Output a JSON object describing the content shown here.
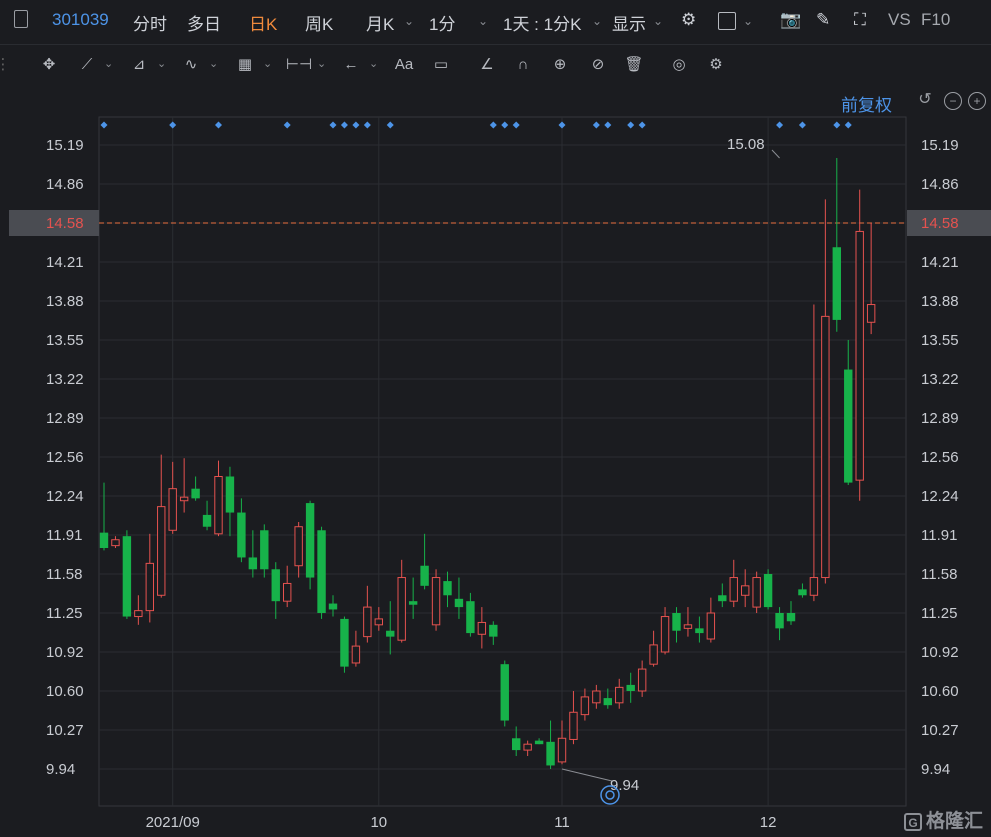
{
  "header": {
    "stock_code": "301039",
    "tabs": [
      "分时",
      "多日",
      "日K",
      "周K",
      "月K",
      "1分"
    ],
    "active_tab": "日K",
    "period_select": "1天 : 1分K",
    "display_label": "显示",
    "vs_label": "VS",
    "f10_label": "F10"
  },
  "toolbar": {
    "restore_label": "前复权"
  },
  "watermark": {
    "text": "格隆汇",
    "logo": "G"
  },
  "colors": {
    "up": "#e5524f",
    "down": "#17b24a",
    "accent": "#4d94e8",
    "current_price_line": "#e87041"
  },
  "chart_data": {
    "type": "candlestick",
    "y_ticks": [
      "15.19",
      "14.86",
      "14.58",
      "14.21",
      "13.88",
      "13.55",
      "13.22",
      "12.89",
      "12.56",
      "12.24",
      "11.91",
      "11.58",
      "11.25",
      "10.92",
      "10.60",
      "10.27",
      "9.94"
    ],
    "ylim": [
      9.8,
      15.4
    ],
    "current_price": "14.58",
    "x_ticks": [
      {
        "label": "2021/09",
        "index": 6
      },
      {
        "label": "10",
        "index": 24
      },
      {
        "label": "11",
        "index": 40
      },
      {
        "label": "12",
        "index": 58
      }
    ],
    "annotations": [
      {
        "label": "15.08",
        "index": 59,
        "price": 15.08
      },
      {
        "label": "9.94",
        "index": 40,
        "price": 9.94
      }
    ],
    "event_marker_indices": [
      0,
      6,
      10,
      16,
      20,
      21,
      22,
      23,
      25,
      34,
      35,
      36,
      40,
      43,
      44,
      46,
      47,
      59,
      61,
      64,
      65
    ],
    "candles": [
      [
        11.93,
        11.8,
        12.35,
        11.78
      ],
      [
        11.82,
        11.87,
        11.9,
        11.8
      ],
      [
        11.9,
        11.22,
        11.95,
        11.2
      ],
      [
        11.22,
        11.27,
        11.4,
        11.15
      ],
      [
        11.27,
        11.67,
        11.92,
        11.17
      ],
      [
        11.4,
        12.15,
        12.58,
        11.38
      ],
      [
        11.95,
        12.3,
        12.52,
        11.92
      ],
      [
        12.2,
        12.23,
        12.55,
        12.1
      ],
      [
        12.3,
        12.22,
        12.4,
        12.2
      ],
      [
        12.08,
        11.98,
        12.2,
        11.95
      ],
      [
        11.92,
        12.4,
        12.53,
        11.9
      ],
      [
        12.4,
        12.1,
        12.48,
        11.9
      ],
      [
        12.1,
        11.72,
        12.22,
        11.68
      ],
      [
        11.72,
        11.62,
        11.95,
        11.55
      ],
      [
        11.95,
        11.62,
        12.0,
        11.55
      ],
      [
        11.62,
        11.35,
        11.68,
        11.2
      ],
      [
        11.35,
        11.5,
        11.65,
        11.3
      ],
      [
        11.65,
        11.98,
        12.02,
        11.55
      ],
      [
        12.18,
        11.55,
        12.2,
        11.45
      ],
      [
        11.95,
        11.25,
        11.98,
        11.2
      ],
      [
        11.33,
        11.28,
        11.4,
        11.22
      ],
      [
        11.2,
        10.8,
        11.22,
        10.75
      ],
      [
        10.83,
        10.97,
        11.1,
        10.8
      ],
      [
        11.05,
        11.3,
        11.48,
        11.0
      ],
      [
        11.15,
        11.2,
        11.3,
        11.1
      ],
      [
        11.1,
        11.05,
        11.35,
        10.9
      ],
      [
        11.02,
        11.55,
        11.7,
        11.0
      ],
      [
        11.35,
        11.32,
        11.55,
        11.2
      ],
      [
        11.65,
        11.48,
        11.92,
        11.45
      ],
      [
        11.15,
        11.55,
        11.62,
        11.1
      ],
      [
        11.52,
        11.4,
        11.6,
        11.3
      ],
      [
        11.37,
        11.3,
        11.55,
        11.2
      ],
      [
        11.35,
        11.08,
        11.42,
        11.05
      ],
      [
        11.07,
        11.17,
        11.3,
        10.95
      ],
      [
        11.15,
        11.05,
        11.18,
        10.98
      ],
      [
        10.82,
        10.35,
        10.85,
        10.3
      ],
      [
        10.2,
        10.1,
        10.3,
        10.05
      ],
      [
        10.1,
        10.15,
        10.18,
        10.05
      ],
      [
        10.18,
        10.15,
        10.2,
        10.15
      ],
      [
        10.17,
        9.97,
        10.35,
        9.94
      ],
      [
        10.0,
        10.2,
        10.35,
        9.98
      ],
      [
        10.19,
        10.42,
        10.6,
        10.15
      ],
      [
        10.4,
        10.55,
        10.62,
        10.35
      ],
      [
        10.5,
        10.6,
        10.65,
        10.45
      ],
      [
        10.54,
        10.48,
        10.62,
        10.45
      ],
      [
        10.5,
        10.63,
        10.7,
        10.45
      ],
      [
        10.65,
        10.6,
        10.75,
        10.5
      ],
      [
        10.6,
        10.78,
        10.85,
        10.55
      ],
      [
        10.82,
        10.98,
        11.1,
        10.8
      ],
      [
        10.92,
        11.22,
        11.3,
        10.9
      ],
      [
        11.25,
        11.1,
        11.3,
        11.0
      ],
      [
        11.12,
        11.15,
        11.3,
        11.05
      ],
      [
        11.12,
        11.08,
        11.22,
        11.0
      ],
      [
        11.03,
        11.25,
        11.38,
        11.0
      ],
      [
        11.4,
        11.35,
        11.5,
        11.3
      ],
      [
        11.35,
        11.55,
        11.7,
        11.3
      ],
      [
        11.4,
        11.48,
        11.62,
        11.3
      ],
      [
        11.3,
        11.55,
        11.6,
        11.25
      ],
      [
        11.58,
        11.3,
        11.62,
        11.28
      ],
      [
        11.25,
        11.12,
        11.3,
        11.02
      ],
      [
        11.25,
        11.18,
        11.35,
        11.15
      ],
      [
        11.45,
        11.4,
        11.5,
        11.38
      ],
      [
        11.4,
        11.55,
        13.85,
        11.35
      ],
      [
        11.55,
        13.75,
        14.75,
        11.5
      ],
      [
        14.35,
        13.72,
        15.08,
        13.62
      ],
      [
        13.3,
        12.35,
        13.55,
        12.33
      ],
      [
        12.37,
        14.5,
        14.82,
        12.2
      ],
      [
        13.7,
        13.85,
        14.58,
        13.6
      ]
    ]
  }
}
